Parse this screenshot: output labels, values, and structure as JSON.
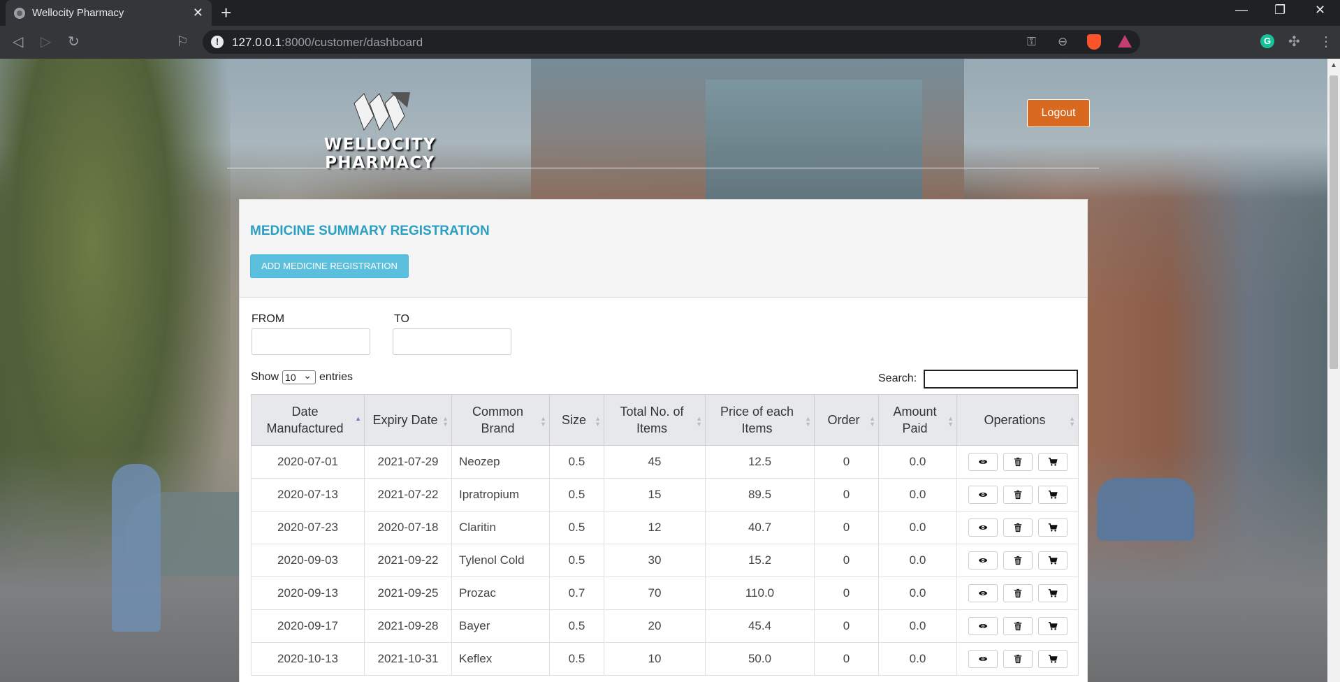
{
  "browser": {
    "tab_title": "Wellocity Pharmacy",
    "url_host": "127.0.0.1",
    "url_rest": ":8000/customer/dashboard"
  },
  "header": {
    "logo_text": "WELLOCITY PHARMACY",
    "logout_label": "Logout"
  },
  "panel": {
    "title": "MEDICINE SUMMARY REGISTRATION",
    "add_button_label": "ADD MEDICINE REGISTRATION",
    "from_label": "FROM",
    "to_label": "TO"
  },
  "table_controls": {
    "show_label": "Show",
    "entries_value": "10",
    "entries_label": "entries",
    "search_label": "Search:"
  },
  "table": {
    "columns": [
      "Date Manufactured",
      "Expiry Date",
      "Common Brand",
      "Size",
      "Total No. of Items",
      "Price of each Items",
      "Order",
      "Amount Paid",
      "Operations"
    ],
    "rows": [
      [
        "2020-07-01",
        "2021-07-29",
        "Neozep",
        "0.5",
        "45",
        "12.5",
        "0",
        "0.0"
      ],
      [
        "2020-07-13",
        "2021-07-22",
        "Ipratropium",
        "0.5",
        "15",
        "89.5",
        "0",
        "0.0"
      ],
      [
        "2020-07-23",
        "2020-07-18",
        "Claritin",
        "0.5",
        "12",
        "40.7",
        "0",
        "0.0"
      ],
      [
        "2020-09-03",
        "2021-09-22",
        "Tylenol Cold",
        "0.5",
        "30",
        "15.2",
        "0",
        "0.0"
      ],
      [
        "2020-09-13",
        "2021-09-25",
        "Prozac",
        "0.7",
        "70",
        "110.0",
        "0",
        "0.0"
      ],
      [
        "2020-09-17",
        "2021-09-28",
        "Bayer",
        "0.5",
        "20",
        "45.4",
        "0",
        "0.0"
      ],
      [
        "2020-10-13",
        "2021-10-31",
        "Keflex",
        "0.5",
        "10",
        "50.0",
        "0",
        "0.0"
      ]
    ]
  },
  "colors": {
    "panel_title": "#2a9fc2",
    "add_button": "#5bc0de",
    "logout_button": "#d9691f"
  }
}
